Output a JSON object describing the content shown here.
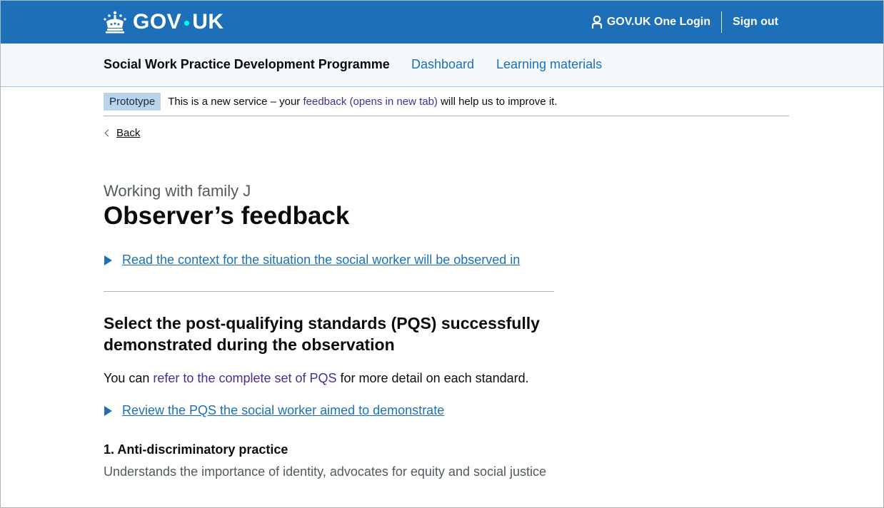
{
  "header": {
    "logo_left": "GOV",
    "logo_right": "UK",
    "one_login_label": "GOV.UK One Login",
    "sign_out_label": "Sign out"
  },
  "service_nav": {
    "service_name": "Social Work Practice Development Programme",
    "links": [
      "Dashboard",
      "Learning materials"
    ]
  },
  "phase_banner": {
    "tag": "Prototype",
    "text_before": "This is a new service – your ",
    "link": "feedback (opens in new tab)",
    "text_after": " will help us to improve it."
  },
  "back_link": "Back",
  "main": {
    "caption": "Working with family J",
    "title": "Observer’s feedback",
    "context_details": "Read the context for the situation the social worker will be observed in",
    "section_heading": "Select the post-qualifying standards (PQS) successfully demonstrated during the observation",
    "body_before": "You can ",
    "body_link": "refer to the complete set of PQS",
    "body_after": " for more detail on each standard.",
    "review_details": "Review the PQS the social worker aimed to demonstrate",
    "standard": {
      "title": "1. Anti-discriminatory practice",
      "hint": "Understands the importance of identity, advocates for equity and social justice"
    }
  },
  "colors": {
    "brand_blue": "#1d70b8",
    "link_visited": "#4c2c92",
    "text": "#0b0c0c",
    "secondary_text": "#505a5f",
    "logo_dot": "#00ffe0"
  }
}
